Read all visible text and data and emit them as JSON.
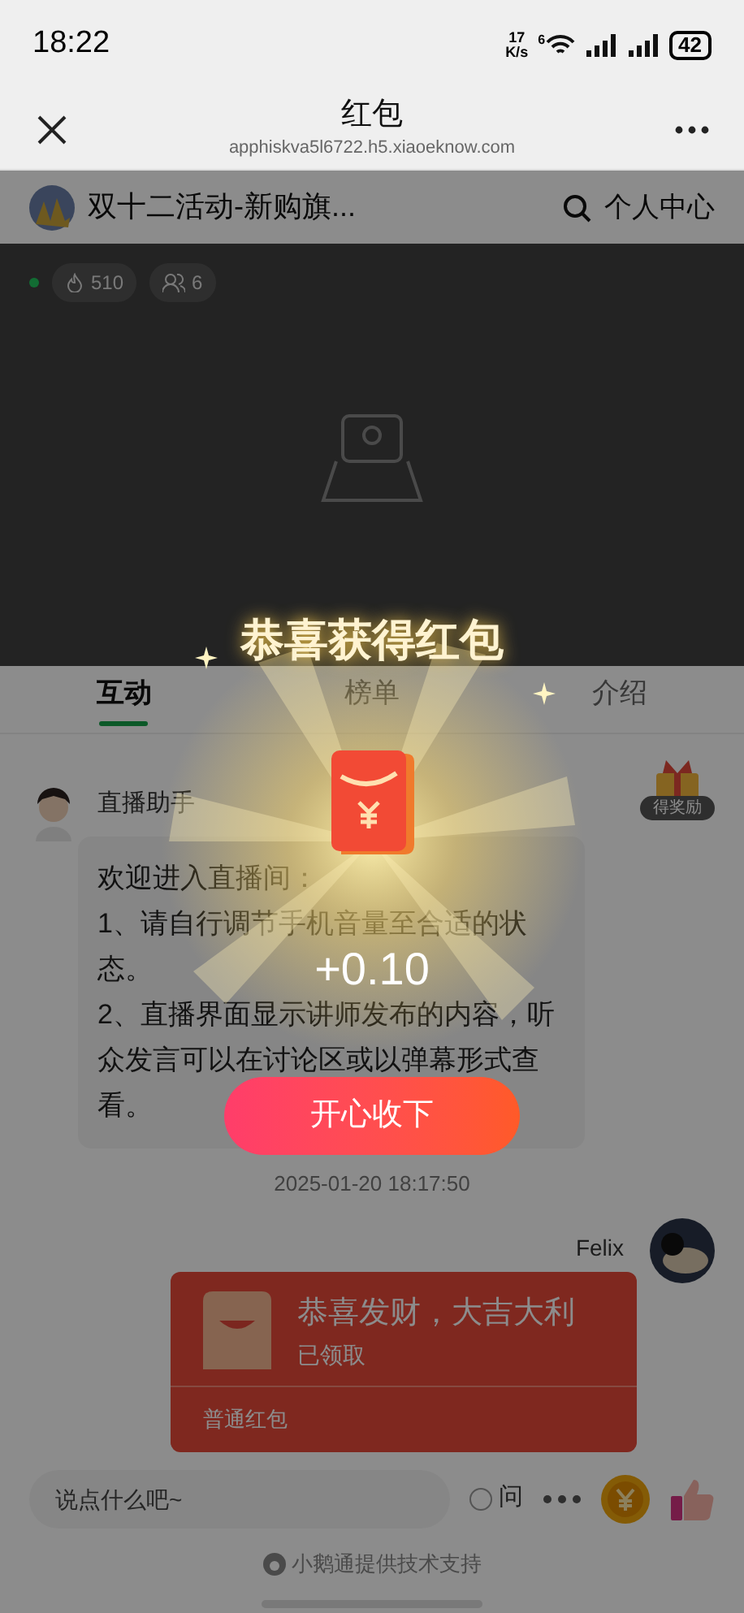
{
  "status_bar": {
    "time": "18:22",
    "net_speed": [
      "17",
      "K/s"
    ],
    "wifi_badge": "6",
    "battery": "42"
  },
  "nav": {
    "title": "红包",
    "url": "apphiskva5l6722.h5.xiaoeknow.com"
  },
  "header": {
    "title": "双十二活动-新购旗...",
    "link": "个人中心"
  },
  "stats": [
    {
      "kind": "fire",
      "value": "510"
    },
    {
      "kind": "people",
      "value": "6"
    }
  ],
  "tabs": [
    {
      "label": "互动",
      "selected": true
    },
    {
      "label": "榜单",
      "selected": false
    },
    {
      "label": "介绍",
      "selected": false
    }
  ],
  "assistant_message": {
    "sender": "直播助手",
    "text": "欢迎进入直播间：\n1、请自行调节手机音量至合适的状态。\n2、直播界面显示讲师发布的内容，听众发言可以在讨论区或以弹幕形式查看。",
    "reward_badge": "得奖励"
  },
  "timestamp": "2025-01-20 18:17:50",
  "user_message": {
    "sender": "Felix",
    "red_packet": {
      "title": "恭喜发财，大吉大利",
      "status": "已领取",
      "type": "普通红包"
    }
  },
  "input_bar": {
    "placeholder": "说点什么吧~",
    "ask_toggle": {
      "label": "问",
      "checked": false
    }
  },
  "footer": "小鹅通提供技术支持",
  "popup": {
    "title": "恭喜获得红包",
    "amount": "+0.10",
    "button": "开心收下"
  }
}
